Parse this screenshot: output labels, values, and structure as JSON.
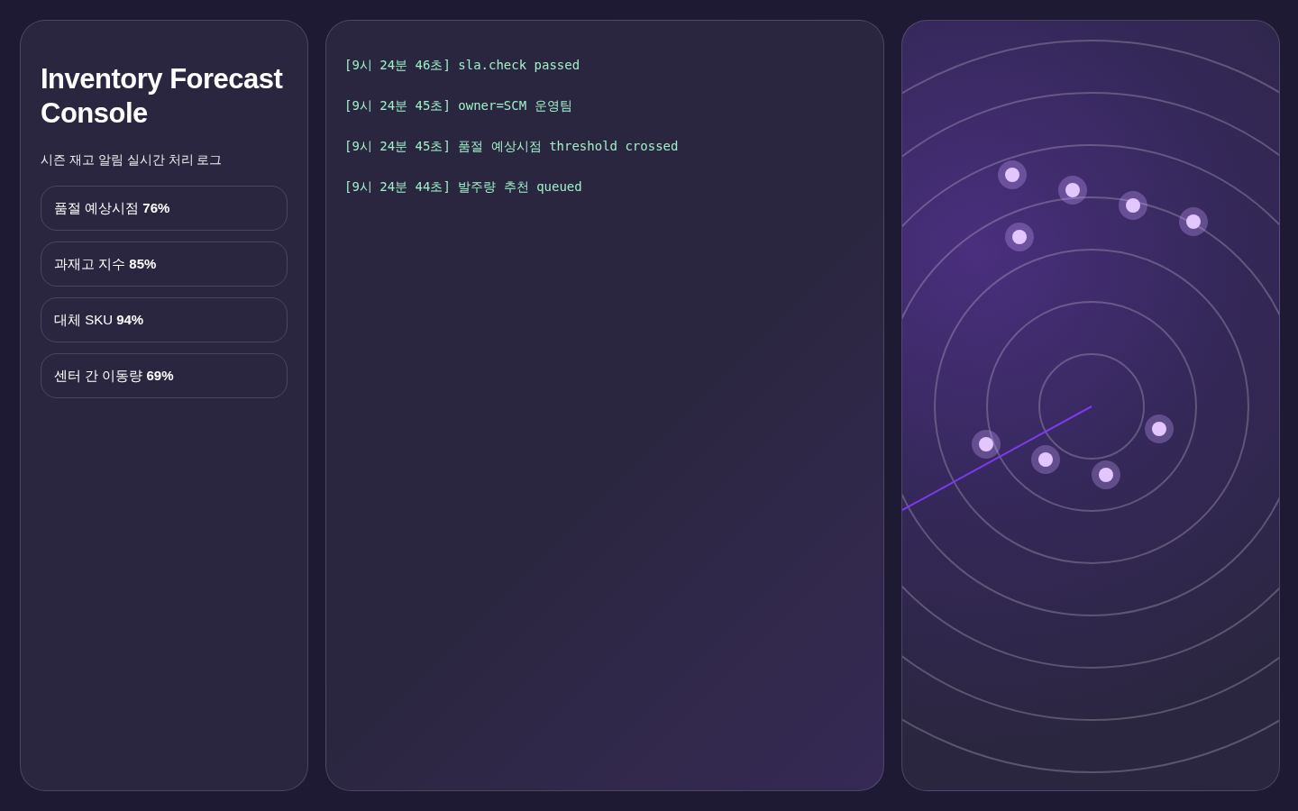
{
  "sidebar": {
    "title": "Inventory Forecast Console",
    "subtitle": "시즌 재고 알림 실시간 처리 로그",
    "metrics": [
      {
        "text": "품절 예상시점 **76%**"
      },
      {
        "text": "과재고 지수 **85%**"
      },
      {
        "text": "대체 SKU **94%**"
      },
      {
        "text": "센터 간 이동량 **69%**"
      }
    ]
  },
  "log": [
    {
      "time": "[9시 24분 46초]",
      "message": "sla.check passed"
    },
    {
      "time": "[9시 24분 45초]",
      "message": "owner=SCM 운영팀"
    },
    {
      "time": "[9시 24분 45초]",
      "message": "품절 예상시점 threshold crossed"
    },
    {
      "time": "[9시 24분 44초]",
      "message": "발주량 추천 queued"
    }
  ]
}
